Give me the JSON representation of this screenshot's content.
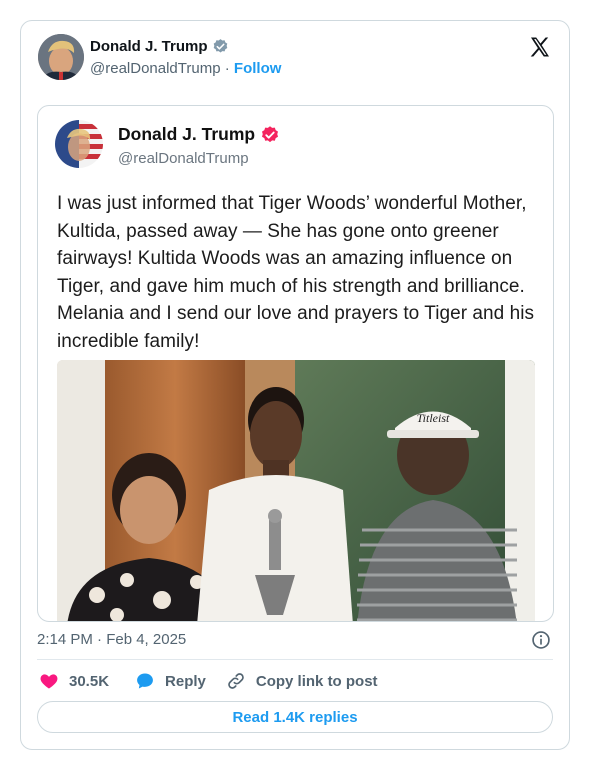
{
  "author": {
    "name": "Donald J. Trump",
    "handle": "@realDonaldTrump",
    "separator": "·",
    "follow_label": "Follow"
  },
  "quoted_post": {
    "name": "Donald J. Trump",
    "handle": "@realDonaldTrump",
    "text": "I was just informed that Tiger Woods’ wonderful Mother, Kultida, passed away — She has gone onto greener fairways! Kultida Woods was an amazing influence on Tiger, and gave him much of his strength and brilliance. Melania and I send our love and prayers to Tiger and his incredible family!",
    "photo_cap_text": "Titleist"
  },
  "timestamp": "2:14 PM · Feb 4, 2025",
  "actions": {
    "likes": "30.5K",
    "reply_label": "Reply",
    "copy_label": "Copy link to post"
  },
  "read_replies_label": "Read 1.4K replies",
  "colors": {
    "link": "#1d9bf0",
    "like": "#f91880",
    "verified_blue": "#829aab",
    "verified_pink": "#f4245e",
    "muted": "#536471"
  },
  "icons": [
    "verified-badge-icon",
    "x-logo-icon",
    "info-icon",
    "heart-icon",
    "reply-bubble-icon",
    "link-icon"
  ]
}
